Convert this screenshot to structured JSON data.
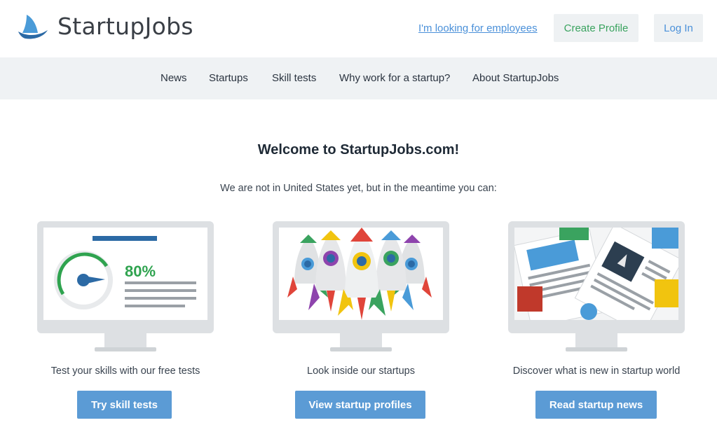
{
  "header": {
    "brand": "StartupJobs",
    "employees_link": "I'm looking for employees",
    "create_profile": "Create Profile",
    "login": "Log In"
  },
  "nav": {
    "items": [
      "News",
      "Startups",
      "Skill tests",
      "Why work for a startup?",
      "About StartupJobs"
    ]
  },
  "main": {
    "title": "Welcome to StartupJobs.com!",
    "subtitle": "We are not in United States yet, but in the meantime you can:",
    "cards": [
      {
        "illustration": "skill-test-gauge",
        "percent": "80%",
        "caption": "Test your skills with our free tests",
        "button": "Try skill tests"
      },
      {
        "illustration": "startup-rockets",
        "caption": "Look inside our startups",
        "button": "View startup profiles"
      },
      {
        "illustration": "startup-newspapers",
        "caption": "Discover what is new in startup world",
        "button": "Read startup news"
      }
    ]
  },
  "colors": {
    "link": "#4a90d9",
    "green": "#3aa35f",
    "button": "#5b9bd5",
    "nav_bg": "#eff2f4",
    "logo": "#2c6aa5"
  }
}
